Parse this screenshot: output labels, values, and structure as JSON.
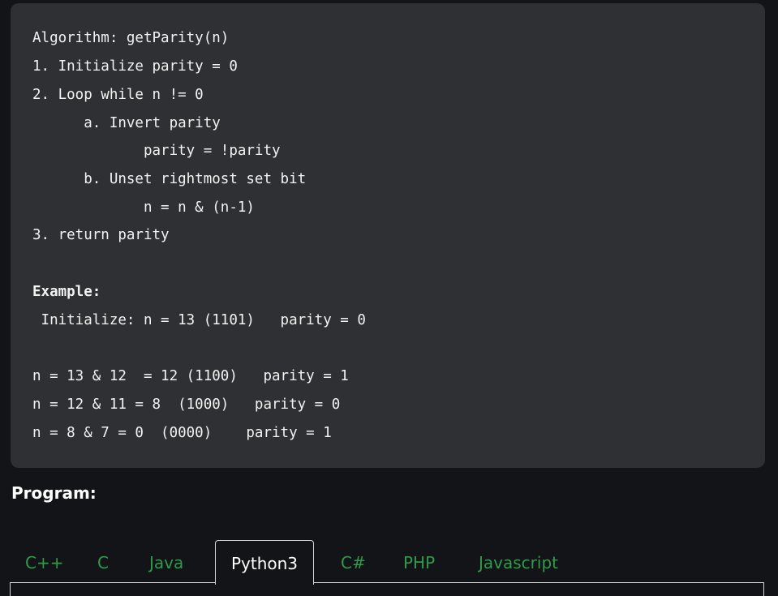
{
  "code_block": {
    "lines": [
      "Algorithm: getParity(n)",
      "1. Initialize parity = 0",
      "2. Loop while n != 0",
      "      a. Invert parity",
      "             parity = !parity",
      "      b. Unset rightmost set bit",
      "             n = n & (n-1)",
      "3. return parity",
      "Example:",
      " Initialize: n = 13 (1101)   parity = 0",
      "n = 13 & 12  = 12 (1100)   parity = 1",
      "n = 12 & 11 = 8  (1000)   parity = 0",
      "n = 8 & 7 = 0  (0000)    parity = 1"
    ]
  },
  "program_heading": "Program:",
  "tabs": [
    {
      "label": "C++",
      "active": false
    },
    {
      "label": "C",
      "active": false
    },
    {
      "label": "Java",
      "active": false
    },
    {
      "label": "Python3",
      "active": true
    },
    {
      "label": "C#",
      "active": false
    },
    {
      "label": "PHP",
      "active": false
    },
    {
      "label": "Javascript",
      "active": false
    }
  ],
  "colors": {
    "background": "#131417",
    "code_background": "#2f3033",
    "tab_text": "#2f9b4a",
    "active_tab_text": "#ffffff",
    "tab_border": "#d6d6d6"
  }
}
